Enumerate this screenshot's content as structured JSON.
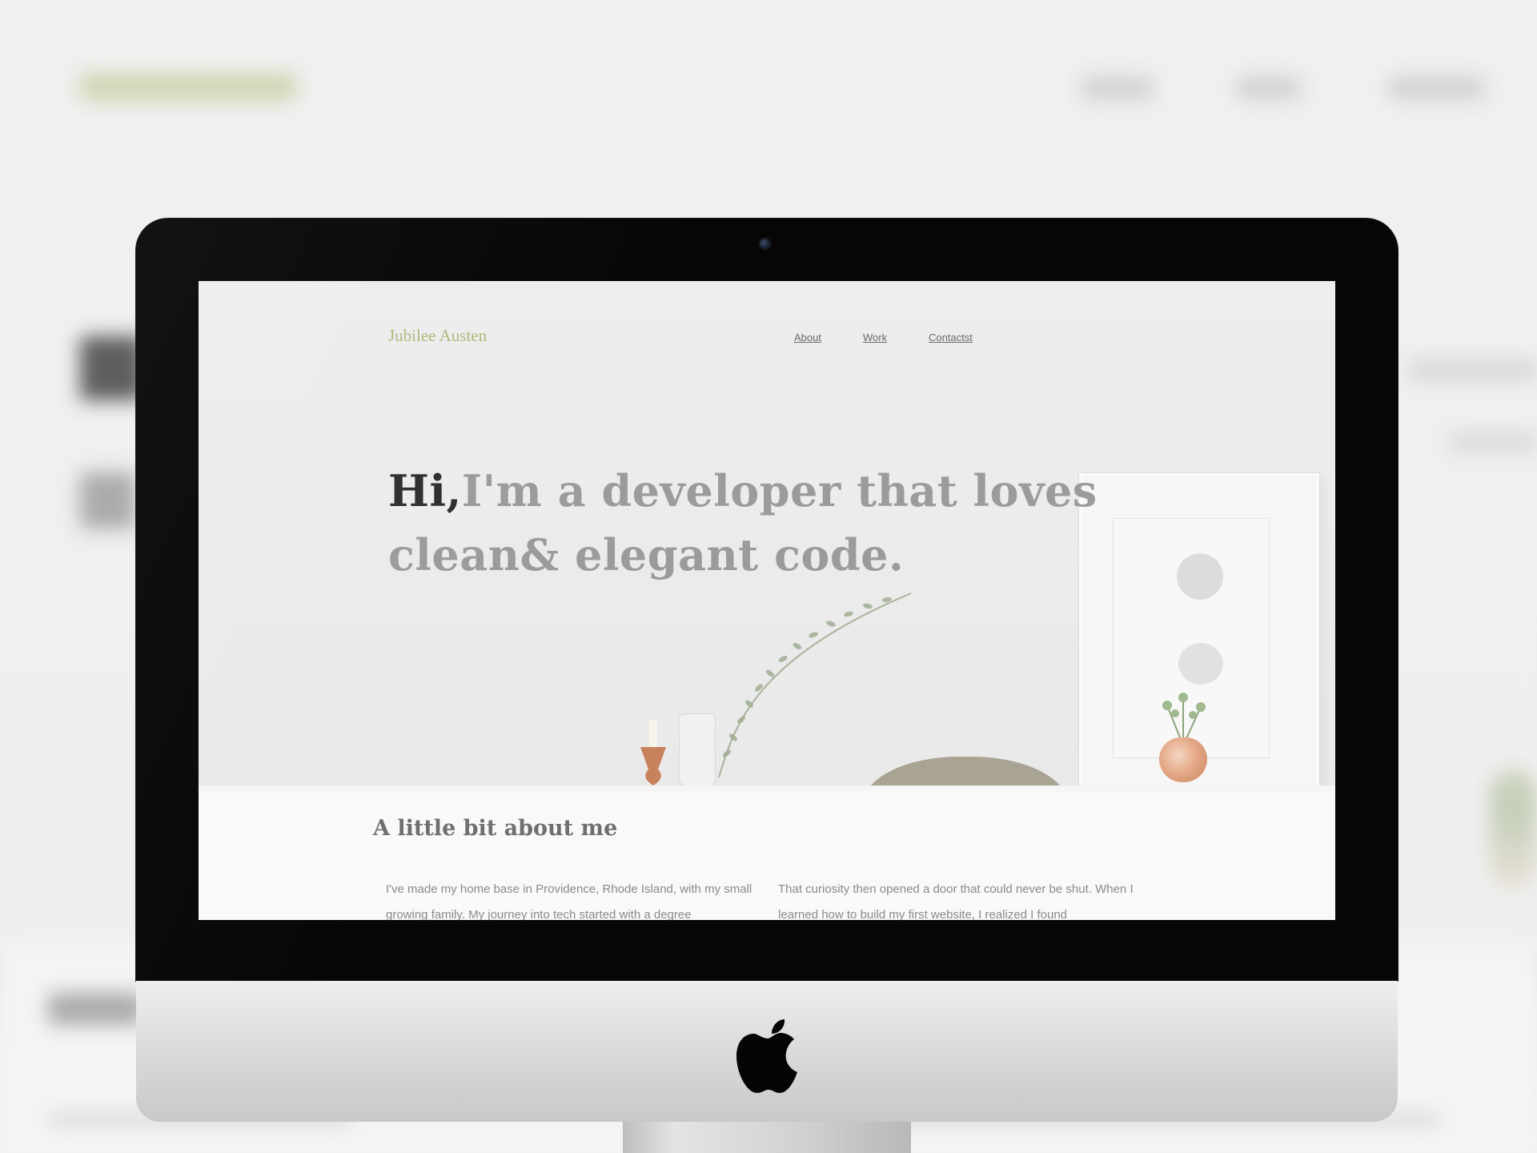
{
  "site": {
    "logo": "Jubilee Austen",
    "nav": [
      {
        "label": "About"
      },
      {
        "label": "Work"
      },
      {
        "label": "Contactst"
      }
    ],
    "hero": {
      "greeting": "Hi,",
      "headline_rest": "I'm a developer that loves clean& elegant code."
    },
    "about": {
      "title": "A little bit about me",
      "col1": "I've made my home base in Providence, Rhode Island, with my small growing family. My journey into tech started with a degree",
      "col2": "That curiosity then opened a door that could never be shut. When I learned how to build my first website, I realized I found"
    }
  },
  "colors": {
    "logo_accent": "#a9b97c",
    "headline_dark": "#2e2e2e",
    "headline_muted": "#9b9b9b",
    "bezel": "#060606",
    "chin": "#dcdcdc"
  },
  "icons": [
    "apple-logo-icon",
    "camera-icon"
  ]
}
